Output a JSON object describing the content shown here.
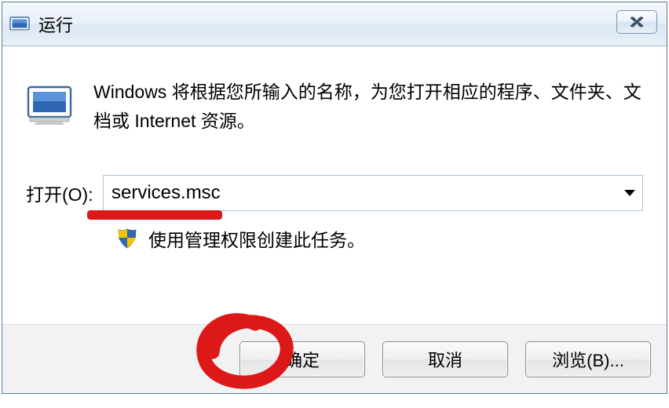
{
  "window": {
    "title": "运行",
    "close_glyph": "✕"
  },
  "description": "Windows 将根据您所输入的名称，为您打开相应的程序、文件夹、文档或 Internet 资源。",
  "open_label": "打开(O):",
  "open_value": "services.msc",
  "admin_note": "使用管理权限创建此任务。",
  "buttons": {
    "ok": "确定",
    "cancel": "取消",
    "browse": "浏览(B)..."
  }
}
